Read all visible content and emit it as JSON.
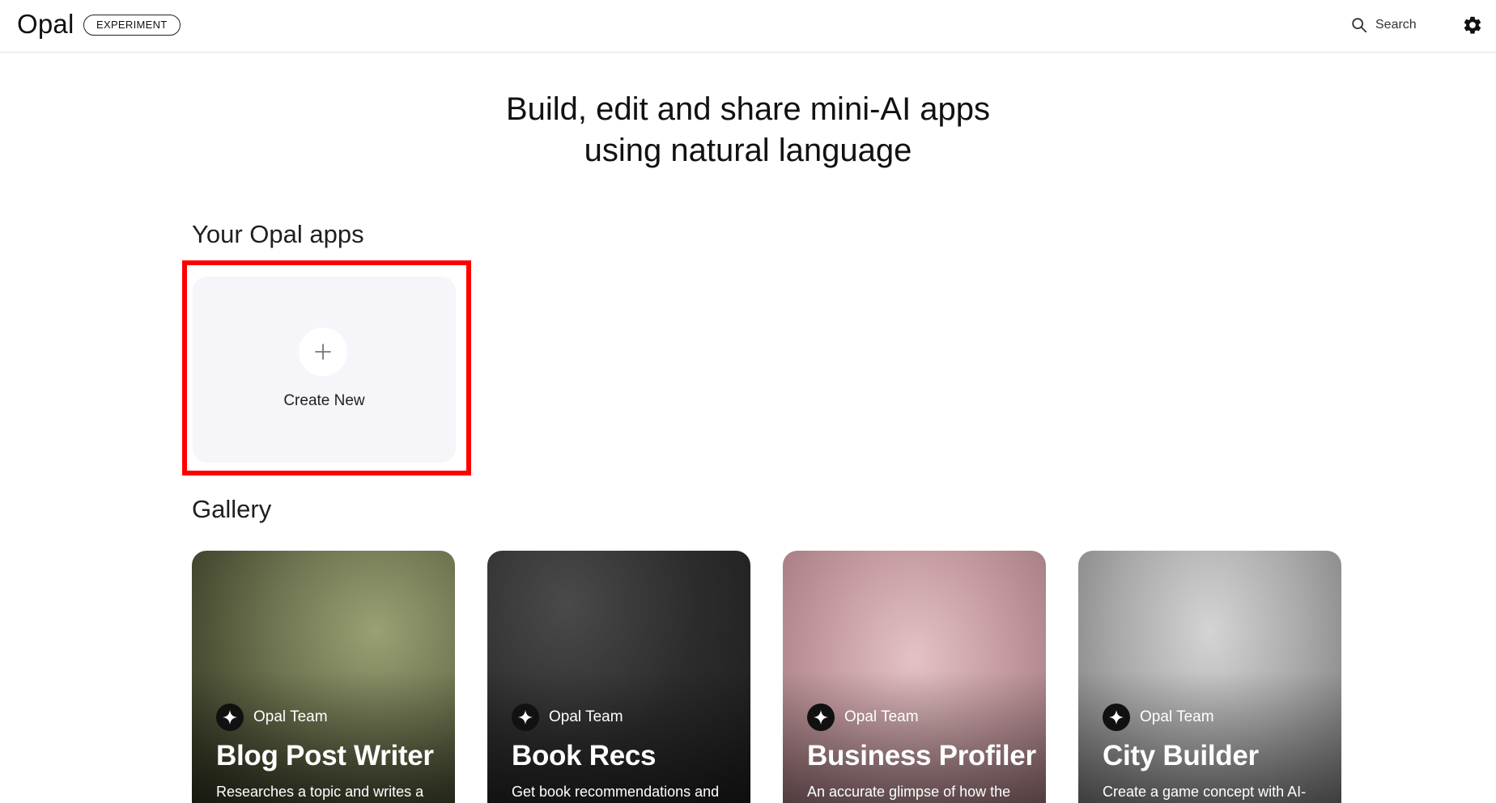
{
  "header": {
    "brand": "Opal",
    "badge": "EXPERIMENT",
    "search_label": "Search"
  },
  "hero": {
    "line1": "Build, edit and share mini-AI apps",
    "line2": "using natural language"
  },
  "your_apps": {
    "title": "Your Opal apps",
    "create_label": "Create New"
  },
  "gallery": {
    "title": "Gallery",
    "cards": [
      {
        "author": "Opal Team",
        "title": "Blog Post Writer",
        "description": "Researches a topic and writes a"
      },
      {
        "author": "Opal Team",
        "title": "Book Recs",
        "description": "Get book recommendations and"
      },
      {
        "author": "Opal Team",
        "title": "Business Profiler",
        "description": "An accurate glimpse of how the"
      },
      {
        "author": "Opal Team",
        "title": "City Builder",
        "description": "Create a game concept with AI-"
      }
    ]
  },
  "colors": {
    "highlight": "#ff0000",
    "create_card_bg": "#f5f5fa"
  },
  "icons": {
    "search": "search-icon",
    "settings": "gear-icon",
    "create": "plus-icon",
    "author": "sparkle-icon"
  }
}
